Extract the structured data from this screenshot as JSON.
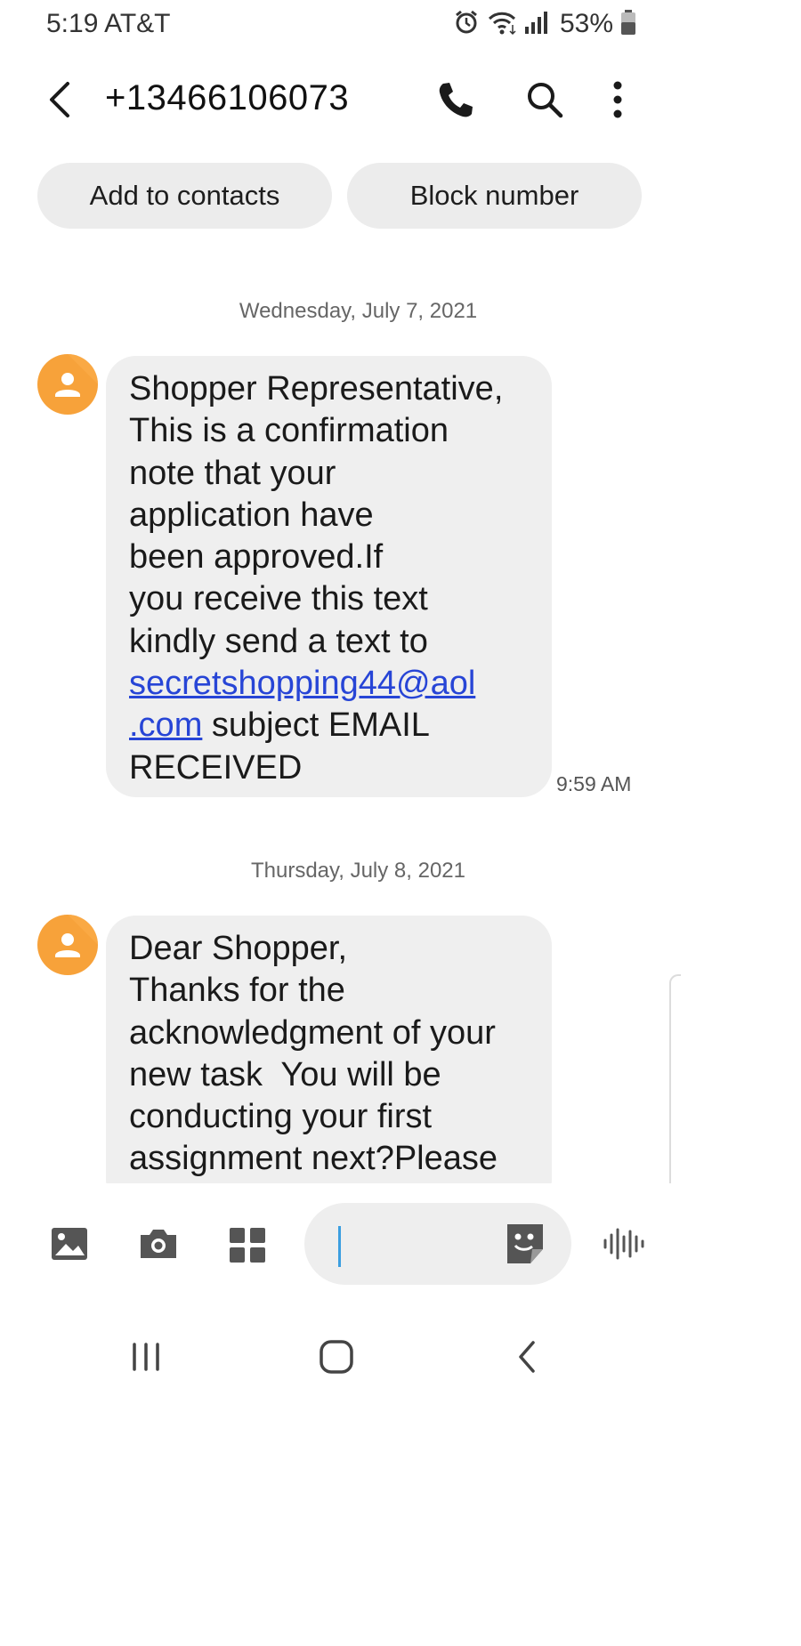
{
  "status_bar": {
    "time_carrier": "5:19 AT&T",
    "battery_percent": "53%",
    "icons": [
      "alarm-icon",
      "wifi-icon",
      "signal-icon",
      "battery-icon"
    ]
  },
  "header": {
    "title": "+13466106073",
    "icons": [
      "back-arrow-icon",
      "phone-icon",
      "search-icon",
      "more-vertical-icon"
    ]
  },
  "actions": {
    "add_to_contacts": "Add to contacts",
    "block_number": "Block number"
  },
  "conversation": [
    {
      "date": "Wednesday, July 7, 2021",
      "message": {
        "text_before_link": "Shopper Representative,\nThis is a confirmation\nnote that your\napplication have\nbeen approved.If\nyou receive this text\nkindly send a text to\n",
        "link": "secretshopping44@aol\n.com",
        "text_after_link": " subject EMAIL\nRECEIVED",
        "time": "9:59 AM"
      }
    },
    {
      "date": "Thursday, July 8, 2021",
      "message": {
        "text": "Dear Shopper,\nThanks for the\nacknowledgment of your\nnew task  You will be\nconducting your first\nassignment next?Please"
      }
    }
  ],
  "compose": {
    "input_value": "",
    "icons": [
      "gallery-icon",
      "camera-icon",
      "apps-grid-icon",
      "sticker-icon",
      "voice-record-icon"
    ]
  },
  "nav_bar": {
    "icons": [
      "recent-apps-icon",
      "home-icon",
      "back-icon"
    ]
  },
  "colors": {
    "avatar": "#f7a23a",
    "bubble": "#efefef",
    "link": "#2745d6",
    "pill": "#ececec",
    "caret": "#3b9ee0"
  }
}
